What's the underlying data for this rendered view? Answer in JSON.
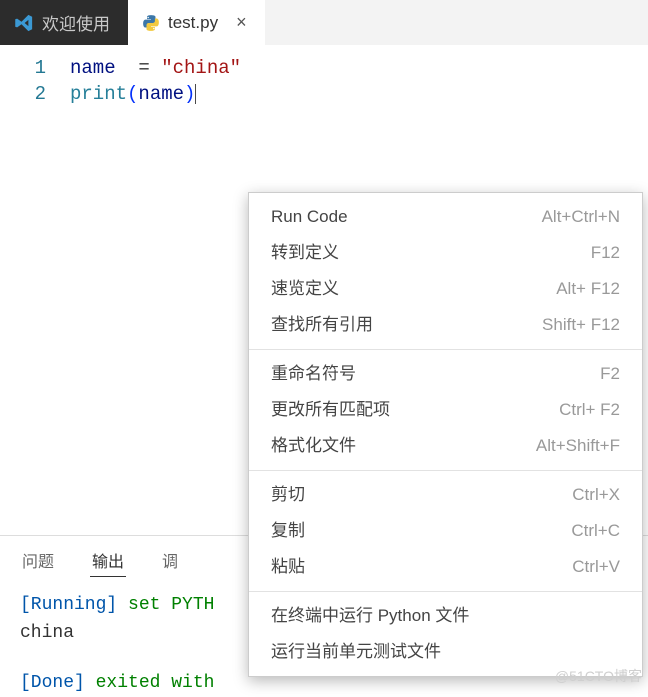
{
  "tabs": {
    "welcome": "欢迎使用",
    "file": "test.py"
  },
  "editor": {
    "lines": [
      "1",
      "2"
    ],
    "l1_name": "name",
    "l1_eq": "  = ",
    "l1_str": "\"china\"",
    "l2_func": "print",
    "l2_lp": "(",
    "l2_arg": "name",
    "l2_rp": ")"
  },
  "panel": {
    "tab_problems": "问题",
    "tab_output": "输出",
    "tab_debug": "调",
    "running_prefix": "[Running]",
    "running_rest": " set PYTH",
    "stdout": "china",
    "done_prefix": "[Done]",
    "done_rest": " exited with"
  },
  "menu": [
    {
      "label": "Run Code",
      "shortcut": "Alt+Ctrl+N"
    },
    {
      "label": "转到定义",
      "shortcut": "F12"
    },
    {
      "label": "速览定义",
      "shortcut": "Alt+ F12"
    },
    {
      "label": "查找所有引用",
      "shortcut": "Shift+ F12"
    },
    {
      "sep": true
    },
    {
      "label": "重命名符号",
      "shortcut": "F2"
    },
    {
      "label": "更改所有匹配项",
      "shortcut": "Ctrl+ F2"
    },
    {
      "label": "格式化文件",
      "shortcut": "Alt+Shift+F"
    },
    {
      "sep": true
    },
    {
      "label": "剪切",
      "shortcut": "Ctrl+X"
    },
    {
      "label": "复制",
      "shortcut": "Ctrl+C"
    },
    {
      "label": "粘贴",
      "shortcut": "Ctrl+V"
    },
    {
      "sep": true
    },
    {
      "label": "在终端中运行 Python 文件",
      "shortcut": ""
    },
    {
      "label": "运行当前单元测试文件",
      "shortcut": ""
    }
  ],
  "watermark": "@51CTO博客"
}
